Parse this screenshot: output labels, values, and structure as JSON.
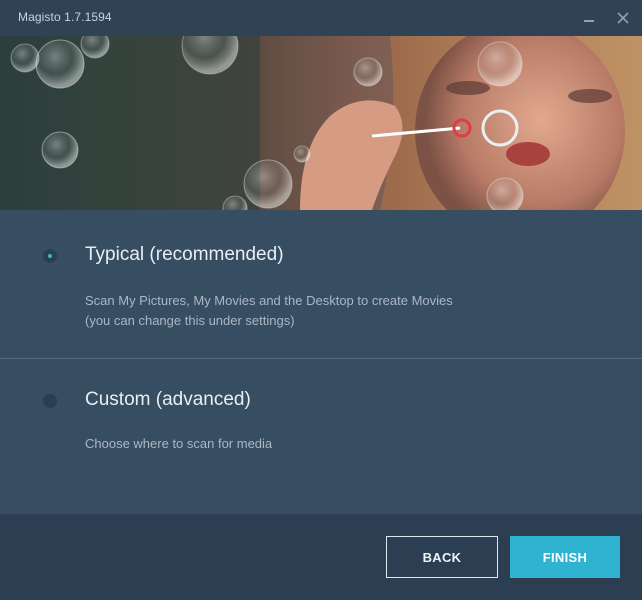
{
  "window": {
    "title": "Magisto 1.7.1594",
    "minimize_icon": "minimize-icon",
    "close_icon": "close-icon"
  },
  "banner": {
    "description_icon": "banner-photo-girl-blowing-bubbles"
  },
  "options": [
    {
      "title": "Typical (recommended)",
      "description_line1": "Scan My Pictures, My Movies and the Desktop to create Movies",
      "description_line2": "(you can change this under settings)",
      "selected": true
    },
    {
      "title": "Custom (advanced)",
      "description_line1": "Choose where to scan for media",
      "selected": false
    }
  ],
  "footer": {
    "back_label": "BACK",
    "finish_label": "FINISH"
  },
  "colors": {
    "accent": "#2fb3d0",
    "background": "#374d62",
    "titlebar": "#2f4256",
    "footer": "#2c3f52"
  }
}
